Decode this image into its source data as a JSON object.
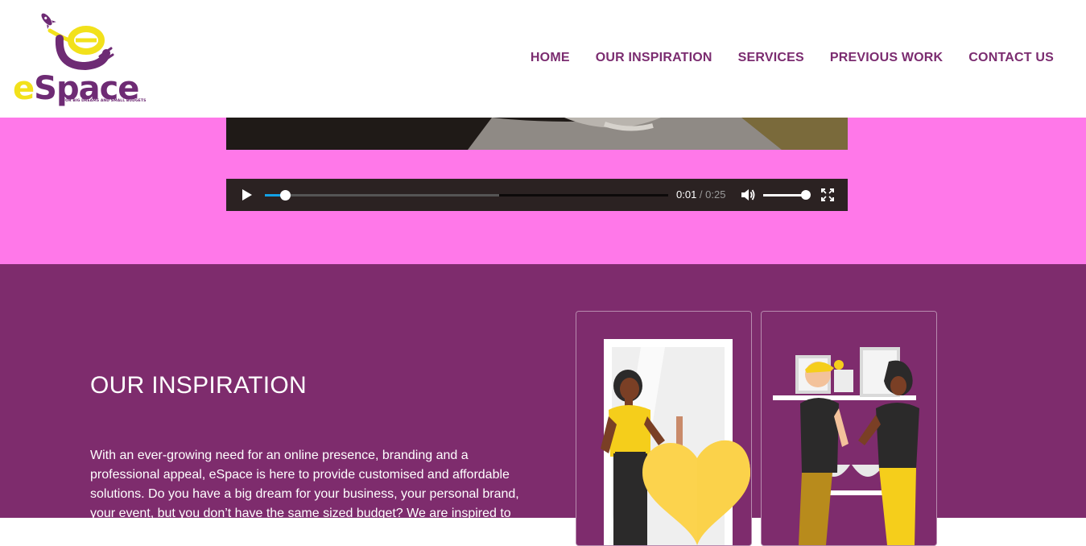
{
  "brand": {
    "logo_first_letter": "e",
    "logo_rest": "Space",
    "tagline": "FOR BIG DREAMS AND SMALL BUDGETS"
  },
  "nav": {
    "items": [
      "HOME",
      "OUR INSPIRATION",
      "SERVICES",
      "PREVIOUS WORK",
      "CONTACT US"
    ]
  },
  "player": {
    "current_time": "0:01",
    "separator": " / ",
    "duration": "0:25",
    "progress_fraction": 0.05,
    "buffered_fraction": 0.58,
    "volume_fraction": 1.0,
    "icons": [
      "play-icon",
      "mute-icon",
      "fullscreen-icon"
    ]
  },
  "inspiration": {
    "title": "OUR INSPIRATION",
    "paragraph": "With an ever-growing need for an online presence, branding and a professional appeal, eSpace is here to provide customised and affordable solutions. Do you have a big dream for your business, your personal brand, your event, but you don’t have the same sized budget? We are inspired to"
  },
  "colors": {
    "brand_purple": "#7b2c70",
    "section_purple": "#7e2c6d",
    "pink": "#ff78e9",
    "brand_yellow": "#f2e11b",
    "player_bg": "#2b2222",
    "progress_blue": "#13a1e6"
  }
}
